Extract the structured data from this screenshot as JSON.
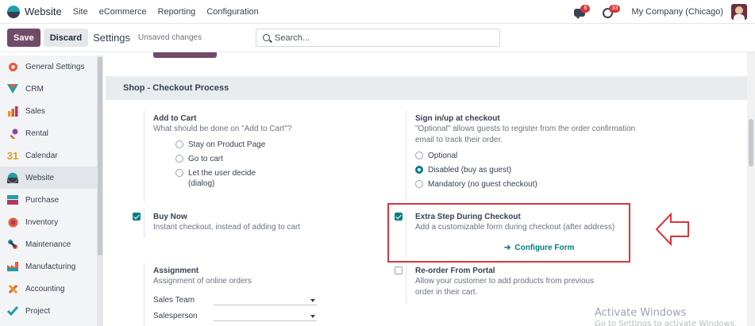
{
  "topnav": {
    "app_title": "Website",
    "menu": [
      "Site",
      "eCommerce",
      "Reporting",
      "Configuration"
    ],
    "chat_badge": "6",
    "activity_badge": "33",
    "company": "My Company (Chicago)"
  },
  "controlbar": {
    "save_label": "Save",
    "discard_label": "Discard",
    "title": "Settings",
    "status": "Unsaved changes",
    "search_placeholder": "Search..."
  },
  "sidebar": {
    "items": [
      {
        "label": "General Settings",
        "icon": "general-settings-icon",
        "color": "#e85d3a"
      },
      {
        "label": "CRM",
        "icon": "crm-icon",
        "color": "#1f9ea8"
      },
      {
        "label": "Sales",
        "icon": "sales-icon",
        "color": "#e85d3a"
      },
      {
        "label": "Rental",
        "icon": "rental-icon",
        "color": "#8e44ad"
      },
      {
        "label": "Calendar",
        "icon": "calendar-icon",
        "color": "#e0a020"
      },
      {
        "label": "Website",
        "icon": "website-icon",
        "color": "#1f9ea8"
      },
      {
        "label": "Purchase",
        "icon": "purchase-icon",
        "color": "#1f9ea8"
      },
      {
        "label": "Inventory",
        "icon": "inventory-icon",
        "color": "#e85d3a"
      },
      {
        "label": "Maintenance",
        "icon": "maintenance-icon",
        "color": "#1f9ea8"
      },
      {
        "label": "Manufacturing",
        "icon": "manufacturing-icon",
        "color": "#e85d3a"
      },
      {
        "label": "Accounting",
        "icon": "accounting-icon",
        "color": "#e85d3a"
      },
      {
        "label": "Project",
        "icon": "project-icon",
        "color": "#1f9ea8"
      }
    ],
    "active_index": 5
  },
  "section": {
    "title": "Shop - Checkout Process"
  },
  "add_to_cart": {
    "title": "Add to Cart",
    "desc": "What should be done on \"Add to Cart\"?",
    "options": [
      "Stay on Product Page",
      "Go to cart",
      "Let the user decide (dialog)"
    ]
  },
  "signin": {
    "title": "Sign in/up at checkout",
    "desc": "\"Optional\" allows guests to register from the order confirmation email to track their order.",
    "options": [
      "Optional",
      "Disabled (buy as guest)",
      "Mandatory (no guest checkout)"
    ],
    "selected_index": 1
  },
  "buy_now": {
    "title": "Buy Now",
    "desc": "Instant checkout, instead of adding to cart",
    "checked": true
  },
  "extra_step": {
    "title": "Extra Step During Checkout",
    "desc": "Add a customizable form during checkout (after address)",
    "link": "Configure Form",
    "checked": true
  },
  "assignment": {
    "title": "Assignment",
    "desc": "Assignment of online orders",
    "fields": [
      "Sales Team",
      "Salesperson"
    ]
  },
  "reorder": {
    "title": "Re-order From Portal",
    "desc": "Allow your customer to add products from previous order in their cart.",
    "checked": false
  },
  "watermark": {
    "line1": "Activate Windows",
    "line2": "Go to Settings to activate Windows."
  },
  "colors": {
    "brand": "#714b67",
    "accent": "#017e84",
    "highlight": "#d9363e"
  }
}
